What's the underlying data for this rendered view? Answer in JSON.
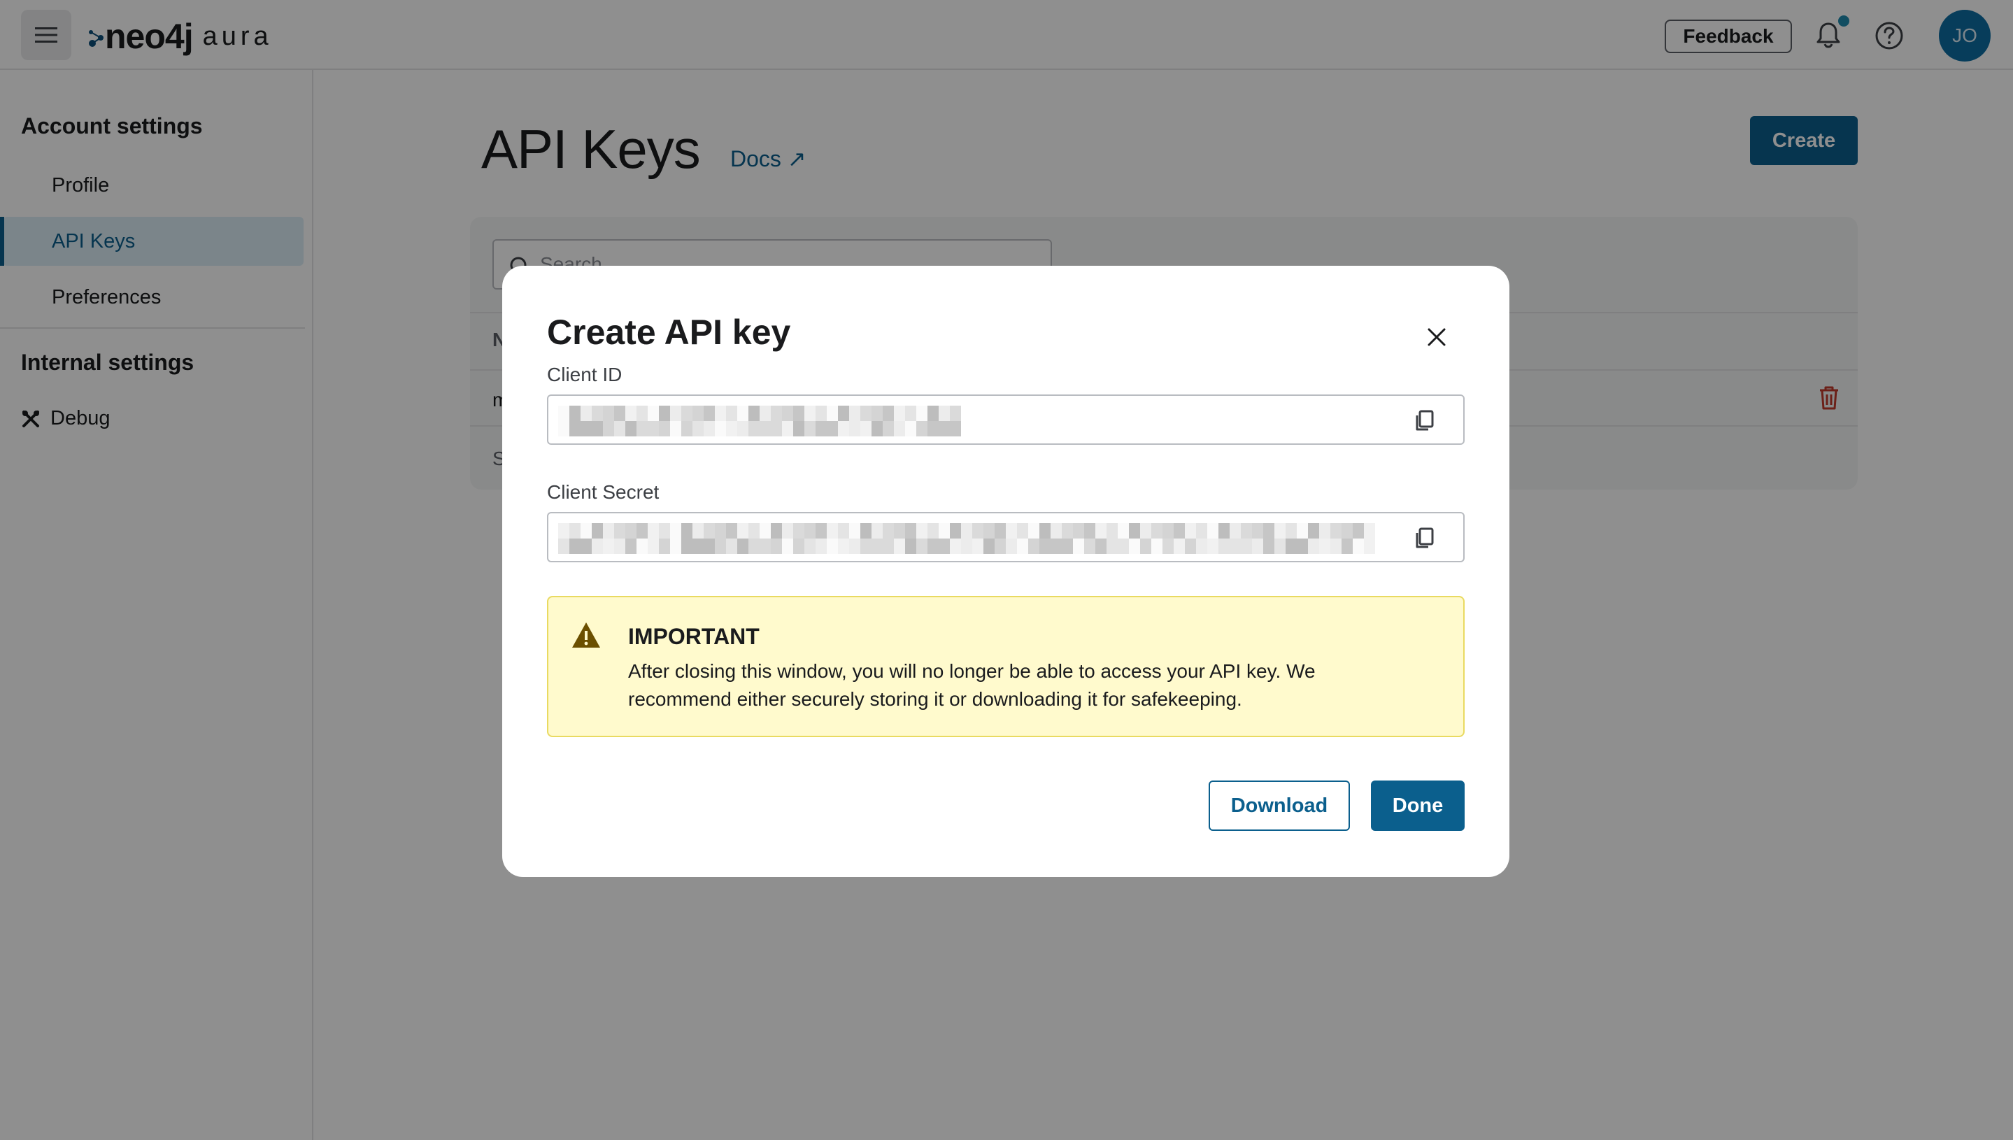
{
  "app": {
    "logo_main": "neo4j",
    "logo_sub": "aura",
    "feedback_label": "Feedback",
    "avatar_initials": "JO",
    "accent_color": "#0b5f8d"
  },
  "sidebar": {
    "account_heading": "Account settings",
    "items": [
      {
        "label": "Profile"
      },
      {
        "label": "API Keys"
      },
      {
        "label": "Preferences"
      }
    ],
    "internal_heading": "Internal settings",
    "debug_label": "Debug"
  },
  "main": {
    "title": "API Keys",
    "docs_label": "Docs ↗",
    "create_label": "Create",
    "search_placeholder": "Search",
    "table_header_initial": "N",
    "row_initial": "m",
    "footer_initial": "S"
  },
  "modal": {
    "title": "Create API key",
    "client_id_label": "Client ID",
    "client_secret_label": "Client Secret",
    "alert_title": "IMPORTANT",
    "alert_text": "After closing this window, you will no longer be able to access your API key. We recommend either securely storing it or downloading it for safekeeping.",
    "download_label": "Download",
    "done_label": "Done"
  }
}
